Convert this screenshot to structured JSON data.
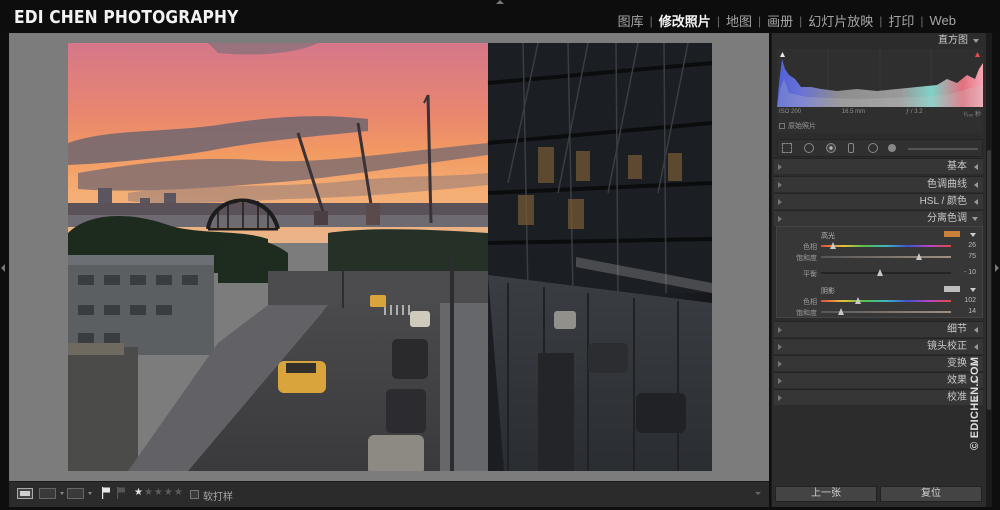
{
  "app": {
    "brand": "EDI CHEN PHOTOGRAPHY",
    "modules": [
      "图库",
      "修改照片",
      "地图",
      "画册",
      "幻灯片放映",
      "打印",
      "Web"
    ],
    "active_module": "修改照片",
    "separator": "|"
  },
  "toolbar": {
    "rating": "★",
    "rating_empty": "★★★★",
    "proof_label": "软打样"
  },
  "histogram": {
    "header": "直方图",
    "iso": "ISO 200",
    "focal": "16.5 mm",
    "aperture": "ƒ / 3.2",
    "shutter": "¹⁄₁₄₀ 秒",
    "original_photo": "原始照片"
  },
  "panels": {
    "basic": "基本",
    "tone_curve": "色调曲线",
    "hsl": "HSL / 颜色",
    "split_toning": "分离色调",
    "detail": "细节",
    "lens": "镜头校正",
    "transform": "变换",
    "effects": "效果",
    "calibration": "校准"
  },
  "split_toning": {
    "highlights": {
      "label": "高光",
      "color": "#c9813a",
      "hue_label": "色相",
      "hue": "26",
      "sat_label": "饱和度",
      "sat": "75"
    },
    "balance_label": "平衡",
    "balance": "- 10",
    "shadows": {
      "label": "阴影",
      "color": "#bdbdbd",
      "hue_label": "色相",
      "hue": "102",
      "sat_label": "饱和度",
      "sat": "14"
    }
  },
  "buttons": {
    "prev": "上一张",
    "reset": "复位"
  },
  "watermark": "© EDICHEN.COM",
  "colors": {
    "accent_highlight": "#c9813a",
    "panel_bg": "#2c2c2c",
    "view_bg": "#7c7c7c"
  }
}
